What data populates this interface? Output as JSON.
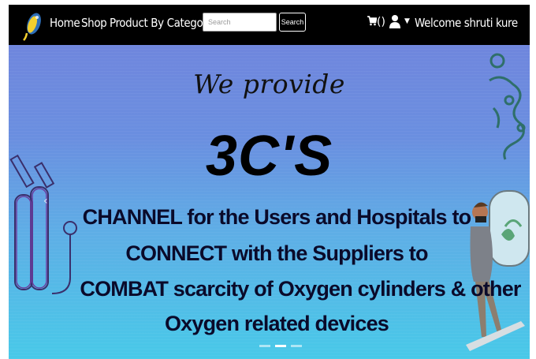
{
  "navbar": {
    "links": [
      "Home",
      "Shop",
      "Product By Category"
    ],
    "search_placeholder": "Search",
    "search_button": "Search",
    "cart_count": "()",
    "welcome": "Welcome shruti kure"
  },
  "hero": {
    "tagline": "We provide",
    "headline": "3C'S",
    "lines": [
      "CHANNEL for the Users and Hospitals to",
      "CONNECT with the Suppliers to",
      "COMBAT scarcity of Oxygen cylinders & other",
      "Oxygen related devices"
    ],
    "active_slide": 2,
    "slide_count": 3
  },
  "colors": {
    "navbar_bg": "#000000",
    "hero_top": "#6f86dd",
    "hero_bottom": "#48c9e8"
  }
}
